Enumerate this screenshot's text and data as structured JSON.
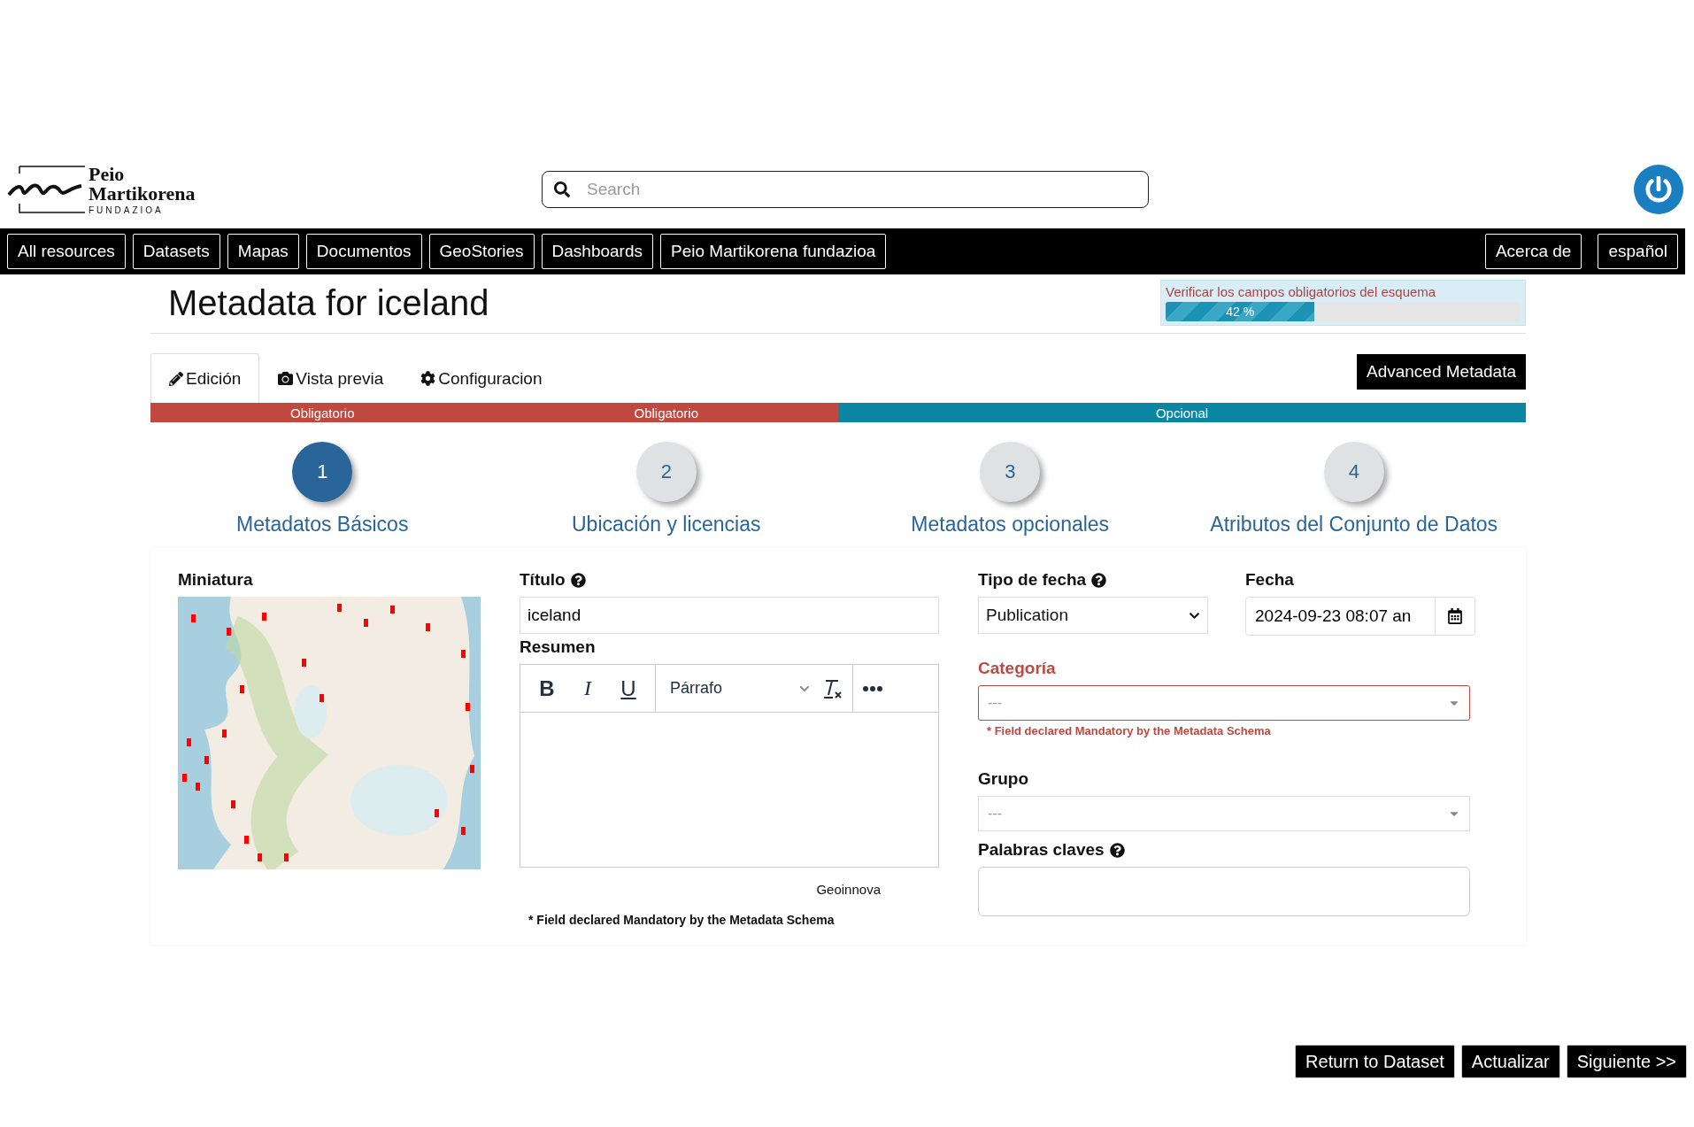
{
  "header": {
    "logo": {
      "line_1": "Peio",
      "line_2": "Martikorena",
      "line_3": "FUNDAZIOA"
    },
    "search": {
      "placeholder": "Search"
    }
  },
  "nav": {
    "left": [
      "All resources",
      "Datasets",
      "Mapas",
      "Documentos",
      "GeoStories",
      "Dashboards",
      "Peio Martikorena fundazioa"
    ],
    "right": [
      "Acerca de",
      "español"
    ]
  },
  "page_title": "Metadata for iceland",
  "alert": {
    "message": "Verificar los campos obligatorios del esquema",
    "progress": {
      "level": 0.42,
      "label": "42 %"
    }
  },
  "tabs": [
    {
      "label": "Edición",
      "kind": "edit",
      "selected": true
    },
    {
      "label": "Vista previa",
      "kind": "preview",
      "selected": false
    },
    {
      "label": "Configuracion",
      "kind": "settings",
      "selected": false
    }
  ],
  "advanced_button": "Advanced Metadata",
  "sections": [
    {
      "label": "Obligatorio",
      "kind": "mandatory",
      "wide": false
    },
    {
      "label": "Obligatorio",
      "kind": "mandatory",
      "wide": false
    },
    {
      "label": "Opcional",
      "kind": "optional",
      "wide": true
    }
  ],
  "steps": [
    {
      "number": "1",
      "label": "Metadatos Básicos",
      "selected": true
    },
    {
      "number": "2",
      "label": "Ubicación y licencias",
      "selected": false
    },
    {
      "number": "3",
      "label": "Metadatos opcionales",
      "selected": false
    },
    {
      "number": "4",
      "label": "Atributos del Conjunto de Datos",
      "selected": false
    }
  ],
  "form": {
    "thumbnail": {
      "label": "Miniatura"
    },
    "title": {
      "label": "Título",
      "help": true,
      "value": "iceland"
    },
    "abstract": {
      "label": "Resumen",
      "bold": "B",
      "italic": "I",
      "underline": "U",
      "block_format": "Párrafo",
      "footer": "Geoinnova"
    },
    "mandatory_note": "* Field declared Mandatory by the Metadata Schema",
    "date_type": {
      "label": "Tipo de fecha",
      "help": true,
      "value": "Publication"
    },
    "date": {
      "label": "Fecha",
      "value": "2024-09-23 08:07 an"
    },
    "category": {
      "label": "Categoría",
      "invalid": true,
      "placeholder": "---",
      "error": "* Field declared Mandatory by the Metadata Schema"
    },
    "group": {
      "label": "Grupo",
      "invalid": false,
      "placeholder": "---"
    },
    "keywords": {
      "label": "Palabras claves",
      "help": true
    }
  },
  "footer_buttons": [
    "Return to Dataset",
    "Actualizar",
    "Siguiente >>"
  ]
}
